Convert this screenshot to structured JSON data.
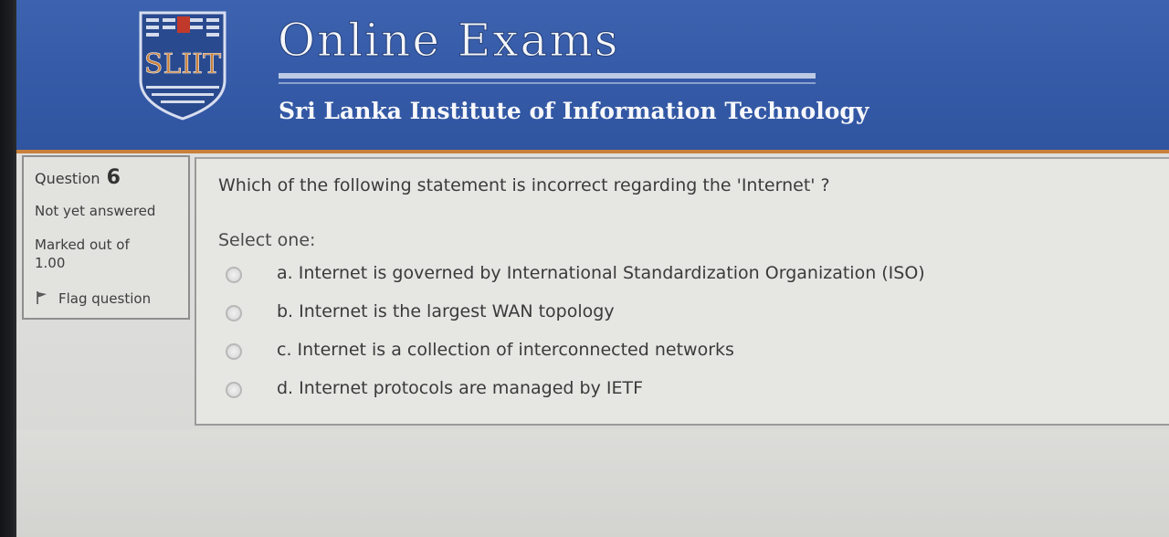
{
  "header": {
    "logo_text": "SLIIT",
    "title": "Online Exams",
    "subtitle": "Sri Lanka Institute of Information Technology"
  },
  "info": {
    "question_label": "Question",
    "question_number": "6",
    "status": "Not yet answered",
    "marked_label": "Marked out of",
    "marked_value": "1.00",
    "flag_label": "Flag question"
  },
  "question": {
    "text": "Which of the following statement is incorrect regarding the 'Internet' ?",
    "select_prompt": "Select one:",
    "options": [
      {
        "label": "a. Internet is governed by International Standardization Organization (ISO)"
      },
      {
        "label": "b. Internet is the largest WAN topology"
      },
      {
        "label": "c. Internet is a collection of interconnected networks"
      },
      {
        "label": "d. Internet protocols are managed by IETF"
      }
    ]
  },
  "colors": {
    "header_blue": "#365ba8",
    "header_accent": "#c9803a",
    "page_bg": "#dcdcda"
  },
  "icons": {
    "flag": "flag-icon",
    "logo": "sliit-logo"
  }
}
